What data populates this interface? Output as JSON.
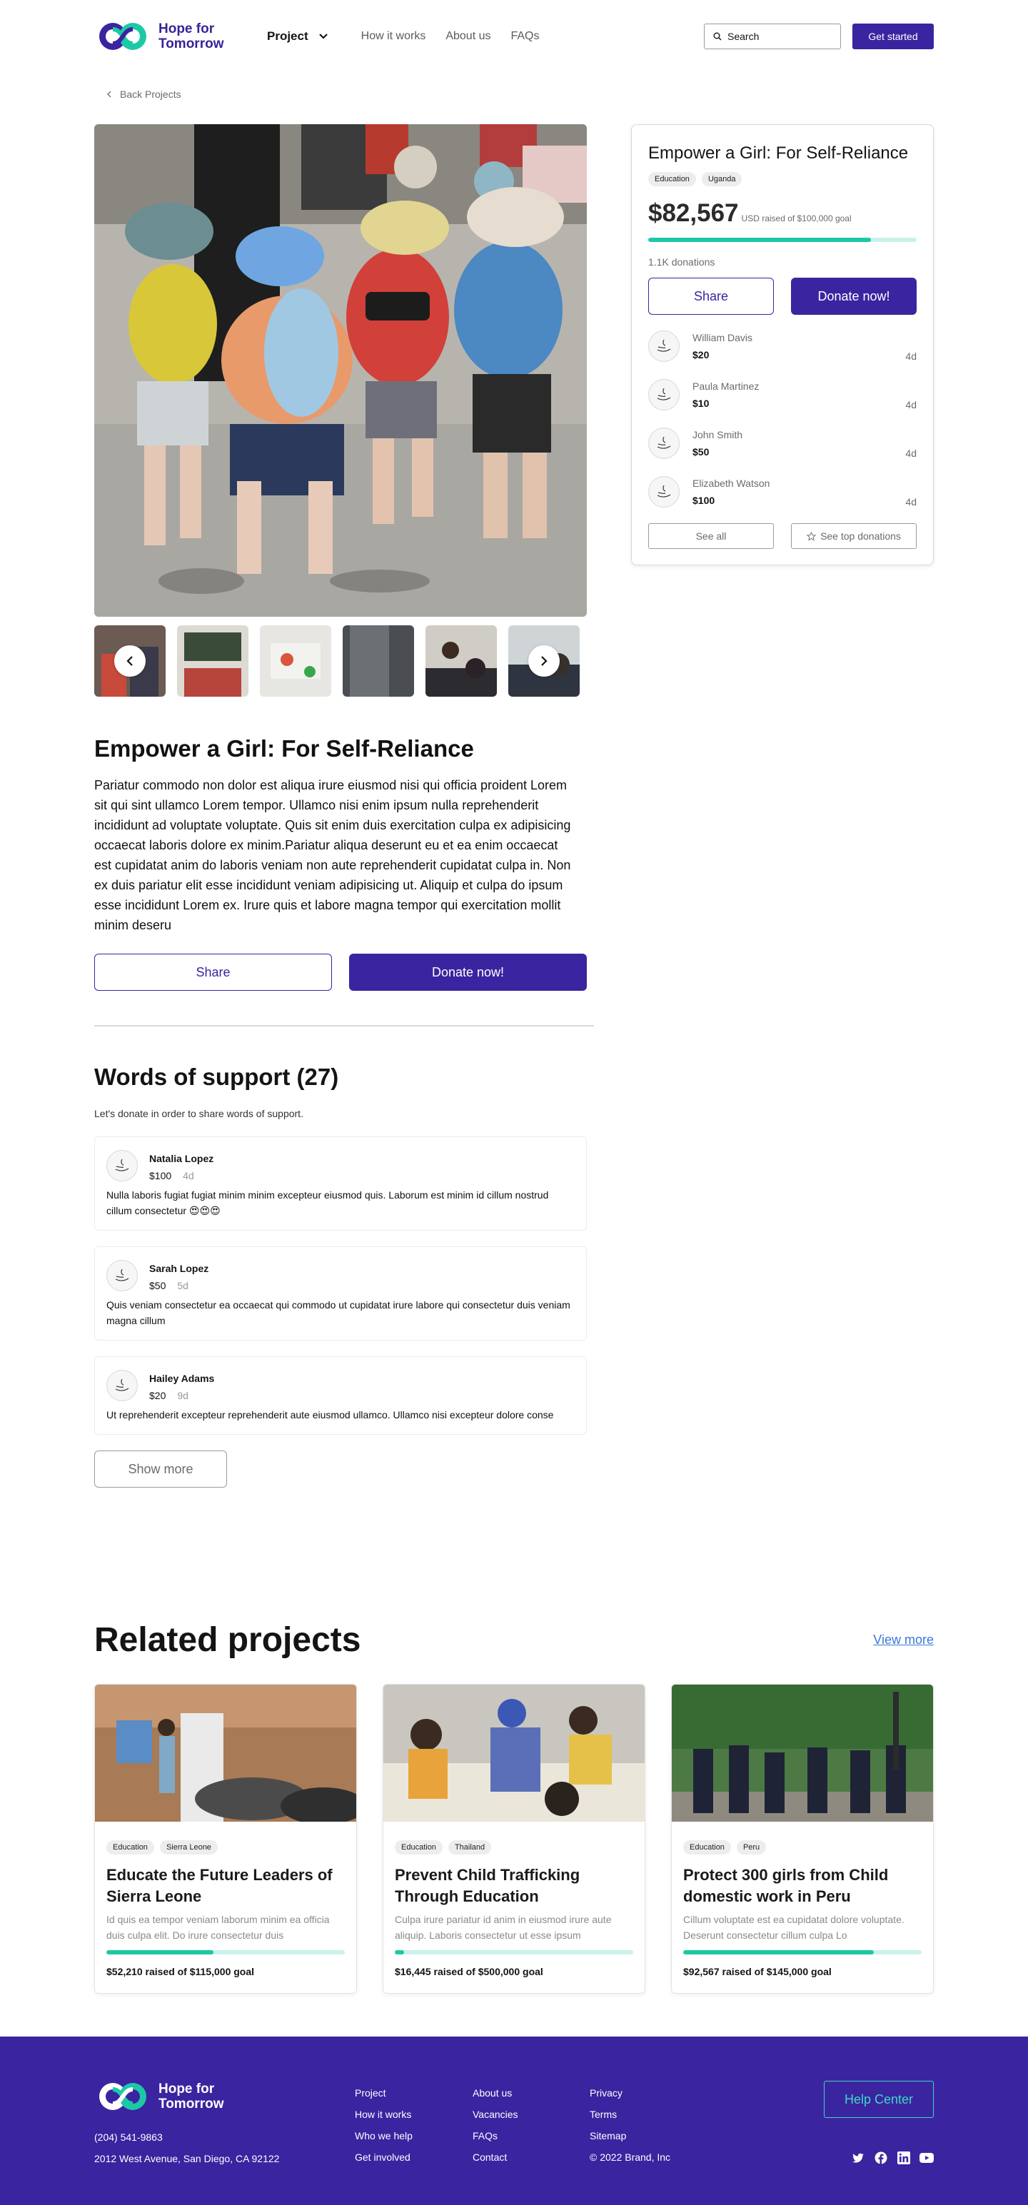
{
  "brand": {
    "name": "Hope for Tomorrow",
    "line1": "Hope for",
    "line2": "Tomorrow"
  },
  "nav": {
    "project": "Project",
    "links": [
      "How it works",
      "About us",
      "FAQs"
    ],
    "search_placeholder": "Search",
    "cta": "Get started"
  },
  "back_link": "Back Projects",
  "project": {
    "title": "Empower a Girl: For Self-Reliance",
    "tags": [
      "Education",
      "Uganda"
    ],
    "raised": "$82,567",
    "goal_text": "USD raised of $100,000 goal",
    "progress": 0.83,
    "donations": "1.1K donations",
    "share": "Share",
    "donate": "Donate now!",
    "description": "Pariatur commodo non dolor est aliqua irure eiusmod nisi qui officia proident Lorem sit qui sint ullamco Lorem tempor. Ullamco nisi enim ipsum nulla reprehenderit incididunt ad voluptate voluptate. Quis sit enim duis exercitation culpa ex adipisicing occaecat laboris dolore ex minim.Pariatur aliqua deserunt eu et ea enim occaecat est cupidatat anim do laboris veniam non aute reprehenderit cupidatat culpa in. Non ex duis pariatur elit esse incididunt veniam adipisicing ut. Aliquip et culpa do ipsum esse incididunt Lorem ex. Irure quis et labore magna tempor qui exercitation mollit minim deseru"
  },
  "donors": [
    {
      "name": "William Davis",
      "amount": "$20",
      "ago": "4d"
    },
    {
      "name": "Paula Martinez",
      "amount": "$10",
      "ago": "4d"
    },
    {
      "name": "John Smith",
      "amount": "$50",
      "ago": "4d"
    },
    {
      "name": "Elizabeth Watson",
      "amount": "$100",
      "ago": "4d"
    }
  ],
  "card_footer": {
    "see_all": "See all",
    "top": "See top donations"
  },
  "support": {
    "title": "Words of support (27)",
    "subtitle": "Let's donate in order to share words of support.",
    "comments": [
      {
        "name": "Natalia Lopez",
        "amount": "$100",
        "ago": "4d",
        "text": "Nulla laboris fugiat fugiat minim minim excepteur eiusmod quis. Laborum est minim id cillum nostrud cillum consectetur 😍😍😍"
      },
      {
        "name": "Sarah Lopez",
        "amount": "$50",
        "ago": "5d",
        "text": "Quis veniam consectetur ea occaecat qui commodo ut cupidatat irure labore qui consectetur duis veniam magna cillum"
      },
      {
        "name": "Hailey Adams",
        "amount": "$20",
        "ago": "9d",
        "text": "Ut reprehenderit excepteur reprehenderit aute eiusmod ullamco. Ullamco nisi excepteur dolore conse"
      }
    ],
    "show_more": "Show more"
  },
  "related": {
    "title": "Related projects",
    "view_more": "View more",
    "items": [
      {
        "tags": [
          "Education",
          "Sierra Leone"
        ],
        "title": "Educate the Future Leaders of Sierra Leone",
        "desc": "Id quis ea tempor veniam laborum minim ea officia duis culpa elit. Do irure consectetur duis",
        "progress": 0.45,
        "raised": "$52,210 raised of $115,000 goal"
      },
      {
        "tags": [
          "Education",
          "Thailand"
        ],
        "title": "Prevent Child Trafficking Through Education",
        "desc": "Culpa irure pariatur id anim in eiusmod irure aute aliquip. Laboris consectetur ut esse ipsum",
        "progress": 0.04,
        "raised": "$16,445 raised of $500,000 goal"
      },
      {
        "tags": [
          "Education",
          "Peru"
        ],
        "title": "Protect 300 girls from Child domestic work in Peru",
        "desc": "Cillum voluptate est ea cupidatat dolore voluptate. Deserunt consectetur cillum culpa Lo",
        "progress": 0.8,
        "raised": "$92,567 raised of $145,000 goal"
      }
    ]
  },
  "footer": {
    "phone": "(204) 541-9863",
    "address": "2012 West Avenue, San Diego, CA 92122",
    "col1": [
      "Project",
      "How it works",
      "Who we help",
      "Get involved"
    ],
    "col2": [
      "About us",
      "Vacancies",
      "FAQs",
      "Contact"
    ],
    "col3": [
      "Privacy",
      "Terms",
      "Sitemap",
      "© 2022 Brand, Inc"
    ],
    "help": "Help Center",
    "socials": [
      "twitter-icon",
      "facebook-icon",
      "linkedin-icon",
      "youtube-icon"
    ]
  },
  "colors": {
    "primary": "#3b24a0",
    "accent": "#1dc8a6",
    "accent_light": "#c9f2ea",
    "link": "#3b78d8"
  }
}
